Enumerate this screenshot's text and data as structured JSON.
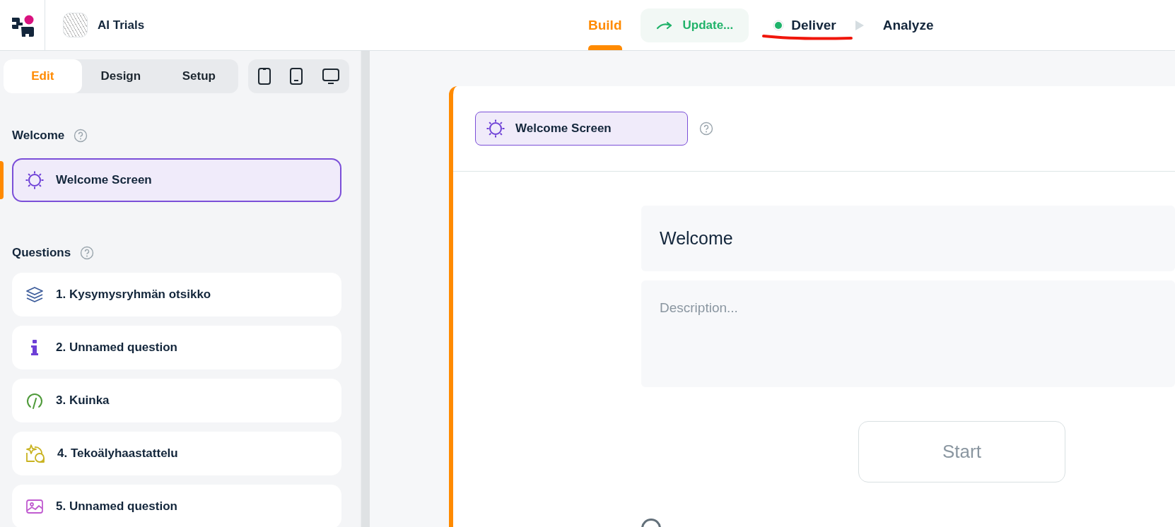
{
  "project": {
    "name": "AI Trials"
  },
  "nav": [
    {
      "label": "Build",
      "kind": "step",
      "selected": true
    },
    {
      "label": "Update...",
      "kind": "action",
      "selected": false
    },
    {
      "label": "Deliver",
      "kind": "status",
      "selected": false
    },
    {
      "label": "Analyze",
      "kind": "step",
      "selected": false
    }
  ],
  "mode_tabs": [
    {
      "label": "Edit",
      "selected": true
    },
    {
      "label": "Design",
      "selected": false
    },
    {
      "label": "Setup",
      "selected": false
    }
  ],
  "devices": [
    {
      "kind": "phone",
      "selected": false
    },
    {
      "kind": "tablet",
      "selected": false
    },
    {
      "kind": "desktop",
      "selected": false
    }
  ],
  "welcome_section": {
    "title": "Welcome",
    "items": [
      {
        "label": "Welcome Screen",
        "selected": true
      }
    ]
  },
  "questions_section": {
    "title": "Questions",
    "items": [
      {
        "label": "1. Kysymysryhmän otsikko",
        "kind": "group",
        "selected": false
      },
      {
        "label": "2. Unnamed question",
        "kind": "info",
        "selected": false
      },
      {
        "label": "3. Kuinka",
        "kind": "scale",
        "selected": false
      },
      {
        "label": "4. Tekoälyhaastattelu",
        "kind": "ai",
        "selected": false
      },
      {
        "label": "5. Unnamed question",
        "kind": "image",
        "selected": false
      }
    ]
  },
  "editor": {
    "chip": "Welcome Screen",
    "title": "Welcome",
    "description_placeholder": "Description...",
    "button": "Start"
  }
}
